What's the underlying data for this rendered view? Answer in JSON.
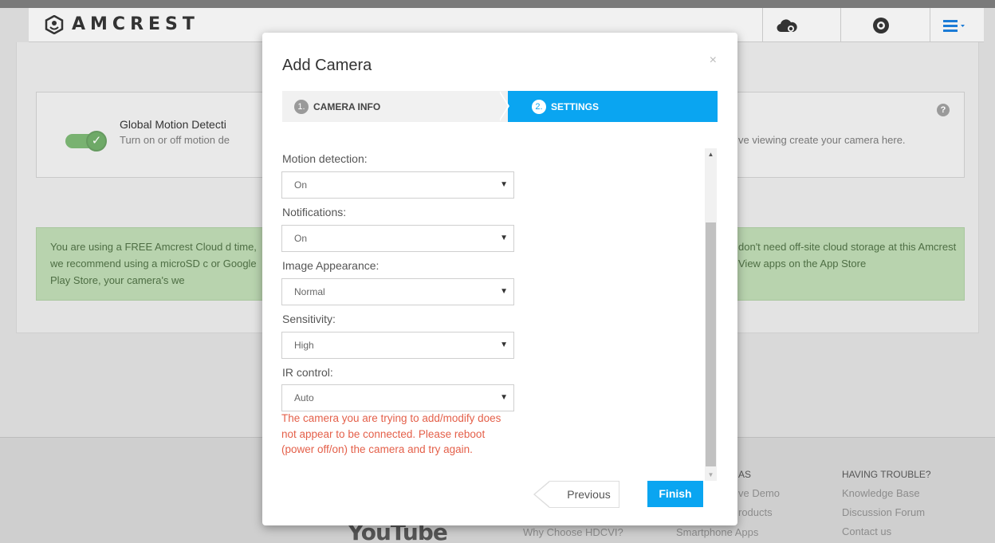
{
  "brand": {
    "name": "AMCREST"
  },
  "nav": {
    "icons": [
      "cloud-settings-icon",
      "eye-icon",
      "menu-icon"
    ]
  },
  "motion_card": {
    "title": "Global Motion Detecti",
    "desc": "Turn on or off motion de",
    "right_text": "ve viewing create your camera here.",
    "help": "?"
  },
  "cloud_alert": {
    "left": "You are using a FREE Amcrest Cloud d time, we recommend using a microSD c or Google Play Store, your camera's we",
    "right": "don't need off-site cloud storage at this Amcrest View apps on the App Store"
  },
  "footer": {
    "col_as": {
      "head": "AS",
      "items": [
        "ve Demo",
        "roducts",
        "Smartphone Apps"
      ]
    },
    "col_trouble": {
      "head": "HAVING TROUBLE?",
      "items": [
        "Knowledge Base",
        "Discussion Forum",
        "Contact us"
      ]
    },
    "why_text": "Why Choose HDCVI?",
    "youtube": "YouTube"
  },
  "modal": {
    "title": "Add Camera",
    "close": "×",
    "steps": [
      {
        "num": "1.",
        "label": "CAMERA INFO"
      },
      {
        "num": "2.",
        "label": "SETTINGS"
      }
    ],
    "fields": [
      {
        "label": "Motion detection:",
        "value": "On"
      },
      {
        "label": "Notifications:",
        "value": "On"
      },
      {
        "label": "Image Appearance:",
        "value": "Normal"
      },
      {
        "label": "Sensitivity:",
        "value": "High"
      },
      {
        "label": "IR control:",
        "value": "Auto"
      }
    ],
    "error": "The camera you are trying to add/modify does not appear to be connected. Please reboot (power off/on) the camera and try again.",
    "prev_label": "Previous",
    "finish_label": "Finish"
  },
  "colors": {
    "accent": "#0aa5f1",
    "error": "#e4604a",
    "alert_bg": "#b8d3ae"
  }
}
